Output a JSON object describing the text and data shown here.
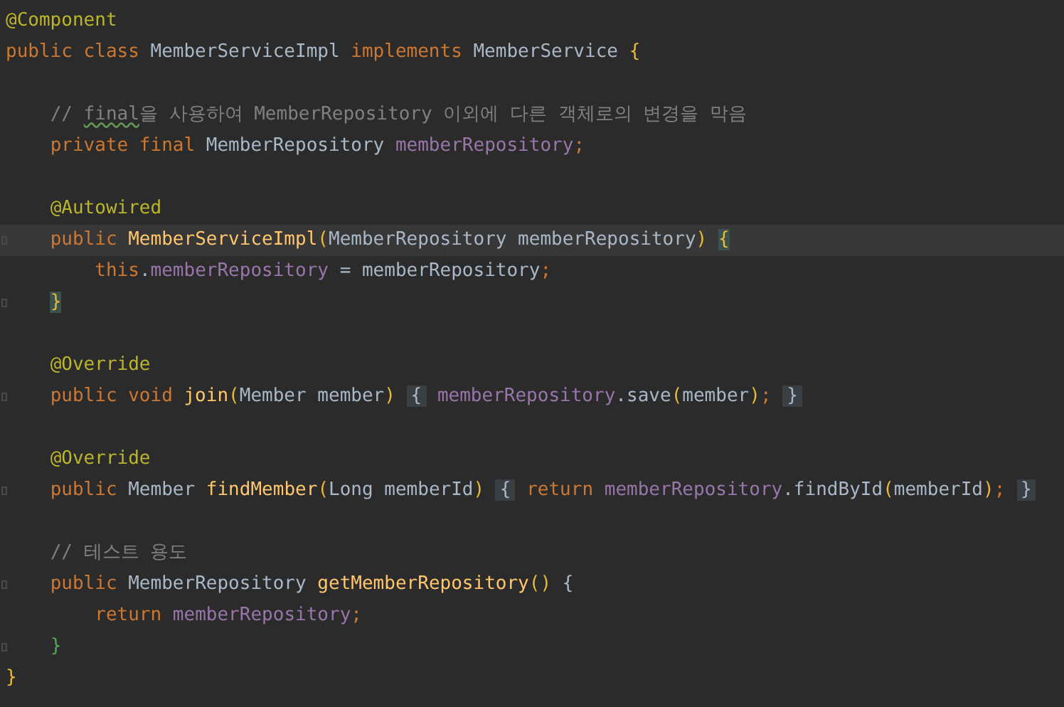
{
  "editor": {
    "lines": [
      {
        "current": false,
        "fold": false,
        "tokens": [
          {
            "text": "@Component",
            "kind": "annotation"
          }
        ]
      },
      {
        "current": false,
        "fold": false,
        "tokens": [
          {
            "text": "public class ",
            "kind": "keyword"
          },
          {
            "text": "MemberServiceImpl ",
            "kind": "plain"
          },
          {
            "text": "implements ",
            "kind": "keyword"
          },
          {
            "text": "MemberService ",
            "kind": "plain"
          },
          {
            "text": "{",
            "kind": "bracket1"
          }
        ]
      },
      {
        "current": false,
        "fold": false
      },
      {
        "current": false,
        "fold": false,
        "tokens": [
          {
            "text": "    // ",
            "kind": "comment"
          },
          {
            "text": "final",
            "kind": "typo"
          },
          {
            "text": "을 사용하여 MemberRepository 이외에 다른 객체로의 변경을 막음",
            "kind": "comment"
          }
        ]
      },
      {
        "current": false,
        "fold": false,
        "tokens": [
          {
            "text": "    private final ",
            "kind": "keyword"
          },
          {
            "text": "MemberRepository ",
            "kind": "plain"
          },
          {
            "text": "memberRepository",
            "kind": "field"
          },
          {
            "text": ";",
            "kind": "keyword"
          }
        ]
      },
      {
        "current": false,
        "fold": false
      },
      {
        "current": false,
        "fold": false,
        "tokens": [
          {
            "text": "    @Autowired",
            "kind": "annotation"
          }
        ]
      },
      {
        "current": true,
        "fold": true,
        "tokens": [
          {
            "text": "    public ",
            "kind": "keyword"
          },
          {
            "text": "MemberServiceImpl",
            "kind": "method"
          },
          {
            "text": "(",
            "kind": "bracket1"
          },
          {
            "text": "MemberRepository memberRepository",
            "kind": "plain"
          },
          {
            "text": ") ",
            "kind": "bracket1"
          },
          {
            "text": "{",
            "kind": "match"
          }
        ]
      },
      {
        "current": false,
        "fold": false,
        "tokens": [
          {
            "text": "        this",
            "kind": "keyword"
          },
          {
            "text": ".",
            "kind": "plain"
          },
          {
            "text": "memberRepository",
            "kind": "field"
          },
          {
            "text": " = memberRepository",
            "kind": "plain"
          },
          {
            "text": ";",
            "kind": "keyword"
          }
        ]
      },
      {
        "current": false,
        "fold": true,
        "tokens": [
          {
            "text": "    }",
            "kind": "match"
          }
        ]
      },
      {
        "current": false,
        "fold": false
      },
      {
        "current": false,
        "fold": false,
        "tokens": [
          {
            "text": "    @Override",
            "kind": "annotation"
          }
        ]
      },
      {
        "current": false,
        "fold": true,
        "tokens": [
          {
            "text": "    public void ",
            "kind": "keyword"
          },
          {
            "text": "join",
            "kind": "method"
          },
          {
            "text": "(",
            "kind": "bracket1"
          },
          {
            "text": "Member member",
            "kind": "plain"
          },
          {
            "text": ") ",
            "kind": "bracket1"
          },
          {
            "text": "{",
            "kind": "folded"
          },
          {
            "text": " memberRepository",
            "kind": "field"
          },
          {
            "text": ".save",
            "kind": "plain"
          },
          {
            "text": "(",
            "kind": "bracket1"
          },
          {
            "text": "member",
            "kind": "plain"
          },
          {
            "text": ")",
            "kind": "bracket1"
          },
          {
            "text": "; ",
            "kind": "keyword"
          },
          {
            "text": "}",
            "kind": "folded"
          }
        ]
      },
      {
        "current": false,
        "fold": false
      },
      {
        "current": false,
        "fold": false,
        "tokens": [
          {
            "text": "    @Override",
            "kind": "annotation"
          }
        ]
      },
      {
        "current": false,
        "fold": true,
        "tokens": [
          {
            "text": "    public ",
            "kind": "keyword"
          },
          {
            "text": "Member ",
            "kind": "plain"
          },
          {
            "text": "findMember",
            "kind": "method"
          },
          {
            "text": "(",
            "kind": "bracket1"
          },
          {
            "text": "Long memberId",
            "kind": "plain"
          },
          {
            "text": ") ",
            "kind": "bracket1"
          },
          {
            "text": "{",
            "kind": "folded"
          },
          {
            "text": " return ",
            "kind": "keyword"
          },
          {
            "text": "memberRepository",
            "kind": "field"
          },
          {
            "text": ".findById",
            "kind": "plain"
          },
          {
            "text": "(",
            "kind": "bracket1"
          },
          {
            "text": "memberId",
            "kind": "plain"
          },
          {
            "text": ")",
            "kind": "bracket1"
          },
          {
            "text": "; ",
            "kind": "keyword"
          },
          {
            "text": "}",
            "kind": "folded"
          }
        ]
      },
      {
        "current": false,
        "fold": false
      },
      {
        "current": false,
        "fold": false,
        "tokens": [
          {
            "text": "    // 테스트 용도",
            "kind": "comment"
          }
        ]
      },
      {
        "current": false,
        "fold": true,
        "tokens": [
          {
            "text": "    public ",
            "kind": "keyword"
          },
          {
            "text": "MemberRepository ",
            "kind": "plain"
          },
          {
            "text": "getMemberRepository",
            "kind": "method"
          },
          {
            "text": "()",
            "kind": "bracket1"
          },
          {
            "text": " {",
            "kind": "plain"
          }
        ]
      },
      {
        "current": false,
        "fold": false,
        "tokens": [
          {
            "text": "        return ",
            "kind": "keyword"
          },
          {
            "text": "memberRepository",
            "kind": "field"
          },
          {
            "text": ";",
            "kind": "keyword"
          }
        ]
      },
      {
        "current": false,
        "fold": true,
        "tokens": [
          {
            "text": "    }",
            "kind": "bracket2"
          }
        ]
      },
      {
        "current": false,
        "fold": false,
        "tokens": [
          {
            "text": "}",
            "kind": "bracket1"
          }
        ]
      }
    ]
  }
}
